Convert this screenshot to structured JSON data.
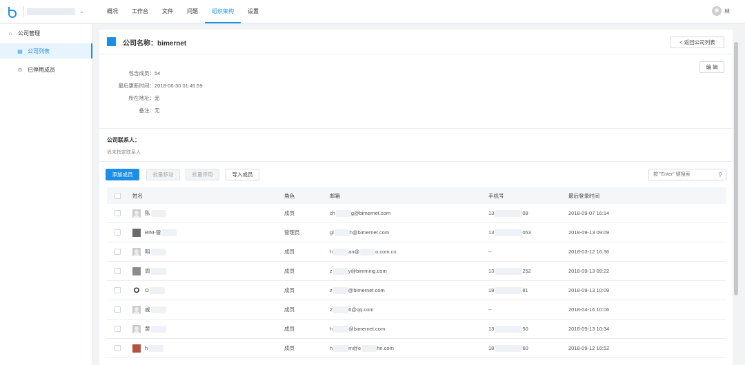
{
  "header": {
    "project_name": "",
    "nav": [
      {
        "label": "概况"
      },
      {
        "label": "工作台"
      },
      {
        "label": "文件"
      },
      {
        "label": "问题"
      },
      {
        "label": "组织架构"
      },
      {
        "label": "设置"
      }
    ],
    "active_nav": "组织架构",
    "user_name": "林"
  },
  "sidebar": {
    "items": [
      {
        "label": "公司管理",
        "icon": "home-icon"
      },
      {
        "label": "公司列表",
        "icon": "list-icon"
      },
      {
        "label": "已停用成员",
        "icon": "ban-icon"
      }
    ]
  },
  "company": {
    "title": "公司名称：bimernet",
    "back_label": "< 返回公司列表",
    "edit_label": "编 辑",
    "info": [
      {
        "label": "包含成员：",
        "value": "54"
      },
      {
        "label": "最后更新时间：",
        "value": "2018-06-30 01:45:59"
      },
      {
        "label": "所在地址：",
        "value": "无"
      },
      {
        "label": "备注：",
        "value": "无"
      }
    ],
    "contact_title": "公司联系人：",
    "contact_empty": "尚未指定联系人"
  },
  "toolbar": {
    "add_label": "添加成员",
    "batch_move_label": "批量移动",
    "batch_disable_label": "批量停用",
    "import_label": "导入成员",
    "search_placeholder": "按 \"Enter\" 键搜索"
  },
  "table": {
    "columns": [
      "姓名",
      "角色",
      "邮箱",
      "手机号",
      "最后登录时间"
    ],
    "rows": [
      {
        "name": "陈",
        "role": "成员",
        "email_a": "ch",
        "email_b": "g@bimernet.com",
        "phone_a": "13",
        "phone_b": "08",
        "last_login": "2018-09-07 16:14"
      },
      {
        "name": "BIM-管",
        "role": "管理员",
        "email_a": "gl",
        "email_b": "h@bimernet.com",
        "phone_a": "13",
        "phone_b": "053",
        "last_login": "2018-09-13 09:09"
      },
      {
        "name": "明",
        "role": "成员",
        "email_a": "h",
        "email_b": "an@",
        "email_c": "o.com.cn",
        "phone_a": "--",
        "phone_b": "",
        "last_login": "2018-03-12 16:36"
      },
      {
        "name": "周",
        "role": "成员",
        "email_a": "z",
        "email_b": "y@bimming.com",
        "phone_a": "13",
        "phone_b": "252",
        "last_login": "2018-09-13 09:22"
      },
      {
        "name": "O",
        "role": "成员",
        "email_a": "z",
        "email_b": "@bimernet.com",
        "phone_a": "18",
        "phone_b": "81",
        "last_login": "2018-09-13 10:09"
      },
      {
        "name": "戚",
        "role": "成员",
        "email_a": "2",
        "email_b": "6@qq.com",
        "phone_a": "--",
        "phone_b": "",
        "last_login": "2018-04-16 10:06"
      },
      {
        "name": "黄",
        "role": "成员",
        "email_a": "h",
        "email_b": "@bimernet.com",
        "phone_a": "13",
        "phone_b": "50",
        "last_login": "2018-09-13 10:34"
      },
      {
        "name": "h",
        "role": "成员",
        "email_a": "h",
        "email_b": "m@e",
        "email_c": "hn.com",
        "phone_a": "18",
        "phone_b": "60",
        "last_login": "2018-09-12 16:52"
      }
    ]
  },
  "colors": {
    "accent": "#1b8fe6"
  }
}
